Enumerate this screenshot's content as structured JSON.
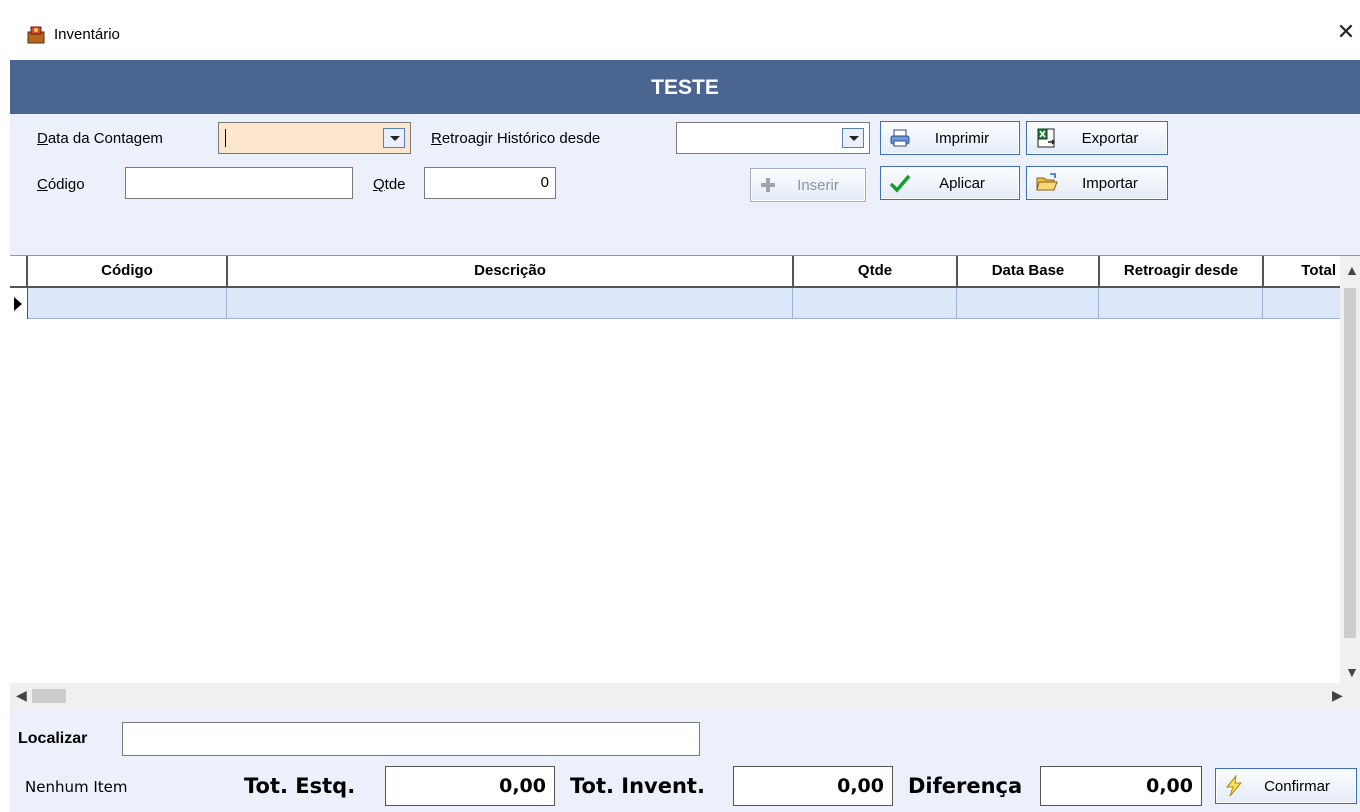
{
  "window": {
    "title": "Inventário",
    "close_symbol": "✕"
  },
  "banner": {
    "text": "TESTE"
  },
  "form": {
    "data_contagem": {
      "label": "Data da Contagem",
      "access_key": "D",
      "value": ""
    },
    "retroagir": {
      "label": "Retroagir Histórico desde",
      "access_key": "R",
      "value": ""
    },
    "codigo": {
      "label": "Código",
      "access_key": "C",
      "value": ""
    },
    "qtde": {
      "label": "Qtde",
      "access_key": "Q",
      "value": "0"
    }
  },
  "buttons": {
    "imprimir": "Imprimir",
    "exportar": "Exportar",
    "inserir": "Inserir",
    "aplicar": "Aplicar",
    "importar": "Importar",
    "confirmar": "Confirmar"
  },
  "grid": {
    "columns": [
      "Código",
      "Descrição",
      "Qtde",
      "Data Base",
      "Retroagir desde",
      "Total"
    ],
    "rows": []
  },
  "footer": {
    "localizar_label": "Localizar",
    "localizar_value": "",
    "status": "Nenhum Item",
    "tot_estq_label": "Tot. Estq.",
    "tot_estq_value": "0,00",
    "tot_invent_label": "Tot. Invent.",
    "tot_invent_value": "0,00",
    "diferenca_label": "Diferença",
    "diferenca_value": "0,00"
  },
  "colors": {
    "banner": "#4a6590",
    "client_bg": "#ebf0fb",
    "highlight_field": "#fde6cf",
    "selected_row": "#dde7fa"
  }
}
